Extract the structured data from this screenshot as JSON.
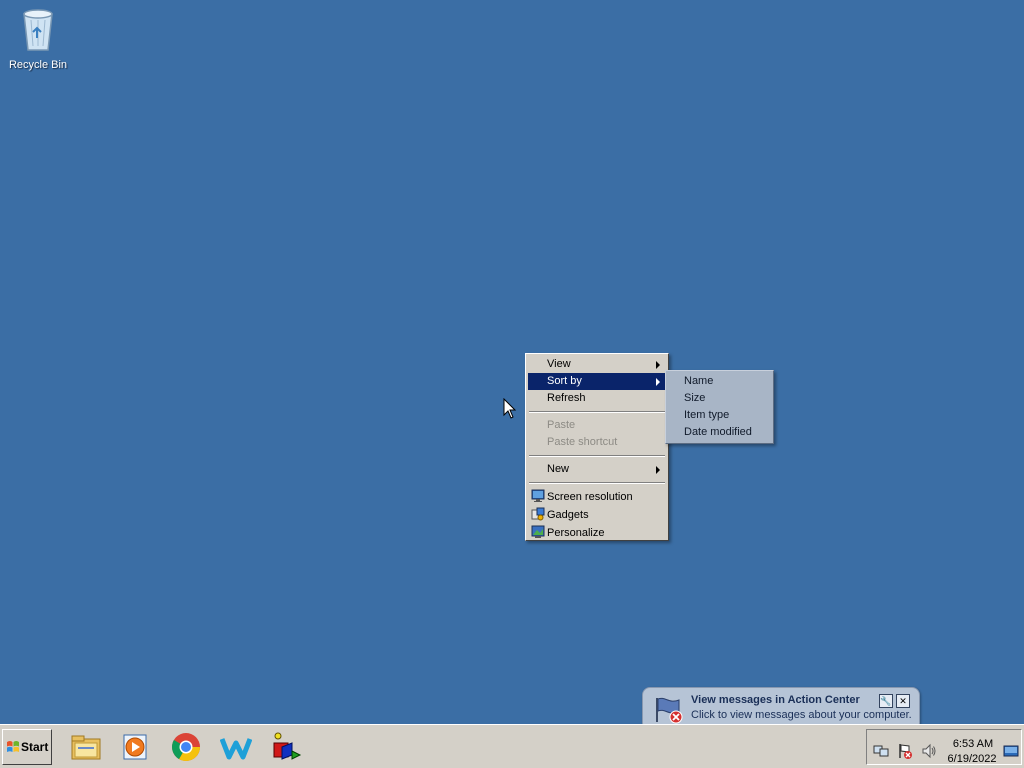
{
  "desktop": {
    "icons": [
      {
        "label": "Recycle Bin",
        "icon": "recycle-bin-icon"
      }
    ],
    "background_color": "#3b6ea5"
  },
  "context_menu": {
    "items": [
      {
        "label": "View",
        "submenu": true
      },
      {
        "label": "Sort by",
        "submenu": true,
        "selected": true
      },
      {
        "label": "Refresh"
      },
      {
        "label": "Paste",
        "disabled": true
      },
      {
        "label": "Paste shortcut",
        "disabled": true
      },
      {
        "label": "New",
        "submenu": true
      },
      {
        "label": "Screen resolution",
        "icon": "screen-resolution-icon"
      },
      {
        "label": "Gadgets",
        "icon": "gadgets-icon"
      },
      {
        "label": "Personalize",
        "icon": "personalize-icon"
      }
    ]
  },
  "sort_submenu": {
    "items": [
      "Name",
      "Size",
      "Item type",
      "Date modified"
    ]
  },
  "notification": {
    "title": "View messages in Action Center",
    "text": "Click to view messages about your computer.",
    "settings_button": "🔧",
    "close_button": "✕",
    "icon": "action-center-flag-icon"
  },
  "taskbar": {
    "start_label": "Start",
    "pinned_apps": [
      "file-explorer-icon",
      "media-player-icon",
      "chrome-icon",
      "w-app-icon",
      "shapes-app-icon"
    ],
    "tray_icons": [
      "network-icon",
      "action-center-icon",
      "volume-icon"
    ],
    "time": "6:53 AM",
    "date": "6/19/2022"
  },
  "colors": {
    "menu_highlight": "#0a246a",
    "menu_bg": "#d4d0c8",
    "taskbar_bg": "#d4d0c8"
  }
}
